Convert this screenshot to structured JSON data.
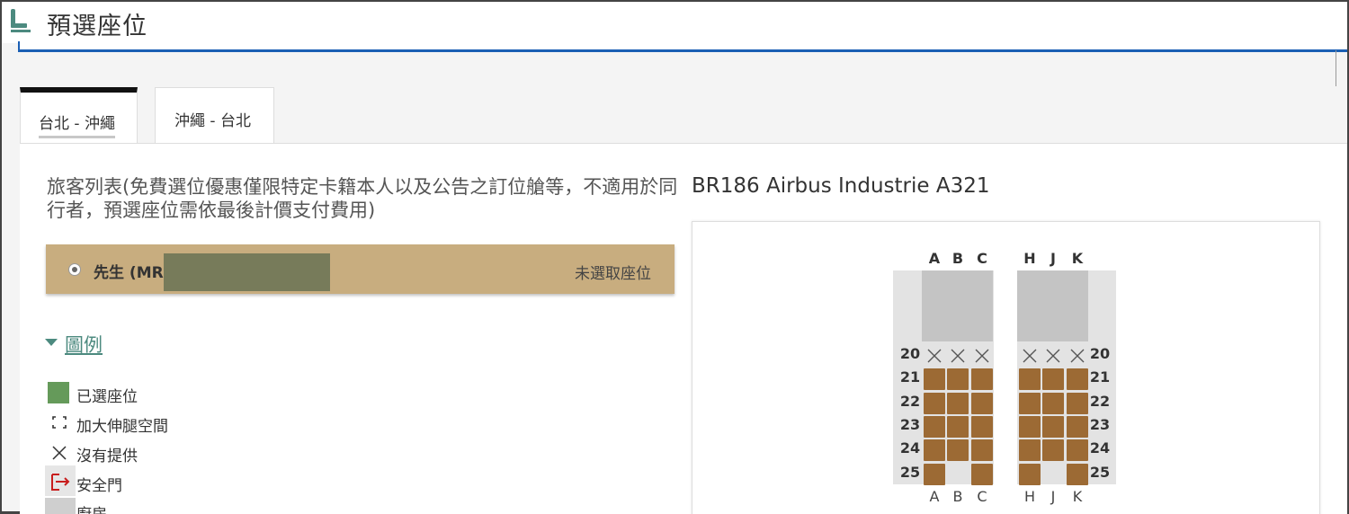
{
  "header": {
    "title": "預選座位",
    "icon": "seat-icon"
  },
  "tabs": [
    {
      "label": "台北 - 沖繩",
      "active": true
    },
    {
      "label": "沖繩 - 台北",
      "active": false
    }
  ],
  "passengers": {
    "heading": "旅客列表(免費選位優惠僅限特定卡籍本人以及公告之訂位艙等，不適用於同行者，預選座位需依最後計價支付費用)",
    "items": [
      {
        "name": "先生 (MR",
        "status": "未選取座位"
      }
    ]
  },
  "legend": {
    "toggle_label": "圖例",
    "items": [
      {
        "label": "已選座位",
        "icon": "selected-seat-swatch"
      },
      {
        "label": "加大伸腿空間",
        "icon": "extra-legroom-icon"
      },
      {
        "label": "沒有提供",
        "icon": "not-available-icon"
      },
      {
        "label": "安全門",
        "icon": "exit-door-icon"
      },
      {
        "label": "廚房",
        "icon": "galley-icon"
      }
    ]
  },
  "aircraft": {
    "title": "BR186 Airbus Industrie A321"
  },
  "seatmap": {
    "left_columns": [
      "A",
      "B",
      "C"
    ],
    "right_columns": [
      "H",
      "J",
      "K"
    ],
    "rows": [
      {
        "number": "20",
        "seats": [
          "x",
          "x",
          "x",
          "x",
          "x",
          "x"
        ]
      },
      {
        "number": "21",
        "seats": [
          "a",
          "a",
          "a",
          "a",
          "a",
          "a"
        ]
      },
      {
        "number": "22",
        "seats": [
          "a",
          "a",
          "a",
          "a",
          "a",
          "a"
        ]
      },
      {
        "number": "23",
        "seats": [
          "a",
          "a",
          "a",
          "a",
          "a",
          "a"
        ]
      },
      {
        "number": "24",
        "seats": [
          "a",
          "a",
          "a",
          "a",
          "a",
          "a"
        ]
      },
      {
        "number": "25",
        "seats": [
          "a",
          "-",
          "a",
          "a",
          "-",
          "a"
        ]
      }
    ],
    "colors": {
      "available": "#9c6a34",
      "selected": "#659a5a",
      "cabin": "#e3e3e3",
      "bulkhead": "#c4c4c4"
    }
  }
}
